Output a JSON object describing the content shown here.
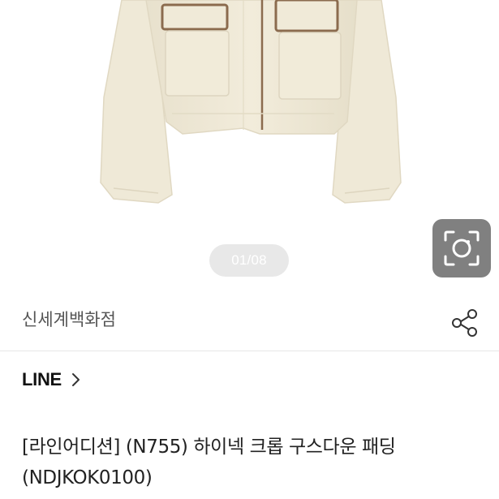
{
  "gallery": {
    "page_indicator": "01/08",
    "lens_icon": "camera-lens-icon"
  },
  "store": {
    "name": "신세계백화점",
    "share_icon": "share-icon"
  },
  "brand": {
    "name": "LINE",
    "chevron_icon": "chevron-right-icon"
  },
  "product": {
    "title": "[라인어디션] (N755) 하이넥 크롭 구스다운 패딩 (NDJKOK0100)"
  },
  "colors": {
    "jacket": "#f0ead8",
    "trim": "#8b6b4e",
    "indicator_bg": "#e8e8e8",
    "lens_button_bg": "#808080"
  }
}
